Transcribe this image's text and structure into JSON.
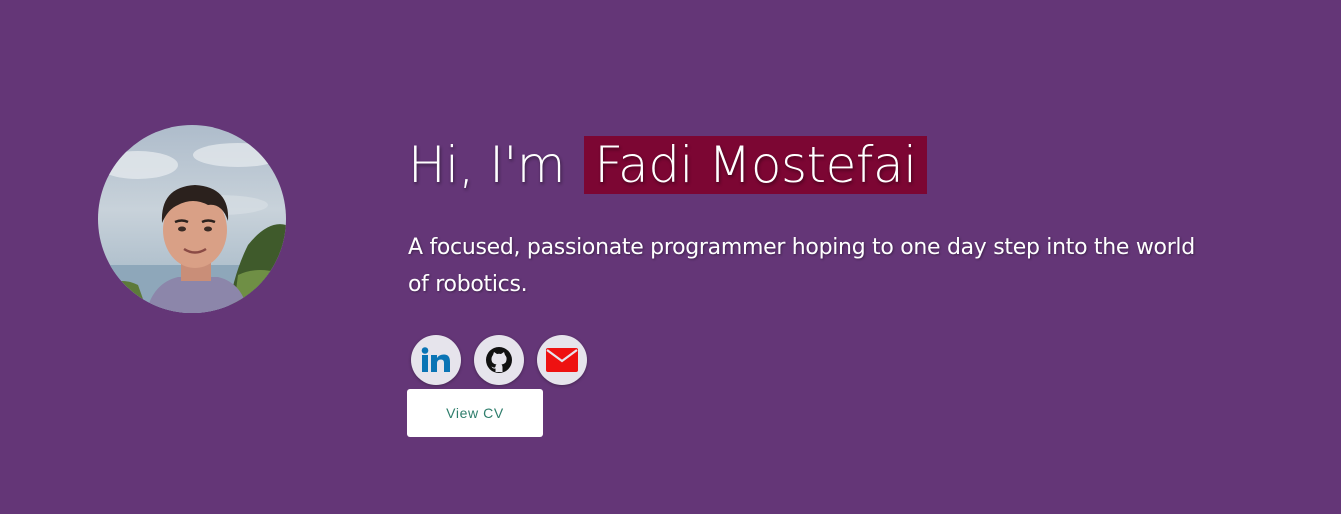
{
  "colors": {
    "background": "#643677",
    "name_highlight": "#7c0633",
    "social_bg": "#e6e4ec",
    "linkedin": "#0a74b5",
    "github": "#111111",
    "email": "#ee1111",
    "cv_text": "#2e7d6b"
  },
  "hero": {
    "greeting_prefix": "Hi, I'm",
    "name": "Fadi Mostefai",
    "tagline": "A focused, passionate programmer hoping to one day step into the world of robotics."
  },
  "socials": [
    {
      "icon": "linkedin-icon"
    },
    {
      "icon": "github-icon"
    },
    {
      "icon": "email-icon"
    }
  ],
  "cv_button": {
    "label": "View CV"
  }
}
